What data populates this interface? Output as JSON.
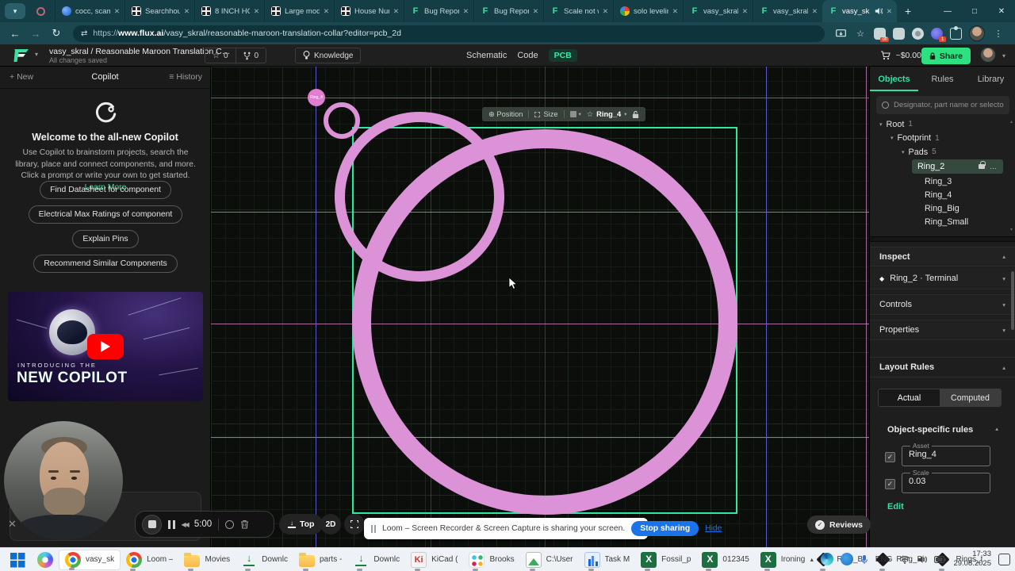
{
  "glyphs": {
    "close": "✕",
    "caret_down": "▾",
    "caret_up": "▴",
    "plus": "+",
    "hamburger": "≡",
    "back": "←",
    "forward": "→",
    "reload": "↻",
    "siteinfo": "⇄",
    "star": "☆",
    "dots_v": "⋮",
    "minimize": "—",
    "maximize": "□",
    "position": "⊕",
    "diamond": "◆",
    "ellipsis": "…",
    "check": "✓",
    "rewind": "◀◀",
    "tray_chevron": "▴",
    "arrow_down": "↓"
  },
  "browser": {
    "tabs": [
      {
        "label": "cocc, scamp",
        "icon": "blue"
      },
      {
        "label": "Searchhous",
        "icon": "grid"
      },
      {
        "label": "8 INCH HO",
        "icon": "grid"
      },
      {
        "label": "Large mode",
        "icon": "grid"
      },
      {
        "label": "House Num",
        "icon": "grid"
      },
      {
        "label": "Bug Report",
        "icon": "flux"
      },
      {
        "label": "Bug Report",
        "icon": "flux"
      },
      {
        "label": "Scale not w",
        "icon": "flux"
      },
      {
        "label": "solo levelin",
        "icon": "google"
      },
      {
        "label": "vasy_skral/",
        "icon": "flux"
      },
      {
        "label": "vasy_skral/",
        "icon": "flux"
      }
    ],
    "active_tab": {
      "label": "vasy_sk",
      "icon": "flux"
    },
    "url_prefix": "https://",
    "url_host": "www.flux.ai",
    "url_path": "/vasy_skral/reasonable-maroon-translation-collar?editor=pcb_2d"
  },
  "header": {
    "project_title": "vasy_skral / Reasonable Maroon Translation C…",
    "saved": "All changes saved",
    "stars": "0",
    "forks": "0",
    "knowledge": "Knowledge",
    "mode_schematic": "Schematic",
    "mode_code": "Code",
    "mode_pcb": "PCB",
    "cart": "~$0.00",
    "share": "Share"
  },
  "copilot": {
    "new": "New",
    "title": "Copilot",
    "history": "History",
    "welcome": "Welcome to the all-new Copilot",
    "body": "Use Copilot to brainstorm projects, search the library, place and connect components, and more. Click a prompt or write your own to get started.",
    "learn_more": "Learn More",
    "prompts": [
      "Find Datasheet for component",
      "Electrical Max Ratings of component",
      "Explain Pins",
      "Recommend Similar Components"
    ],
    "video_intro": "INTRODUCING THE",
    "video_title": "NEW COPILOT"
  },
  "canvas": {
    "toolbar": {
      "position": "Position",
      "size": "Size",
      "ring": "Ring_4"
    },
    "badge": "Ring_4",
    "rings": [
      {
        "style": "left:142px;top:45px;width:46px;height:46px;border-width:6px"
      },
      {
        "style": "left:156px;top:57px;width:214px;height:214px;border-width:13px"
      },
      {
        "style": "left:178px;top:79px;width:486px;height:486px;border-width:24px"
      }
    ],
    "lines": [
      {
        "cls": "gl h pink",
        "style": "top:183px"
      },
      {
        "cls": "gl h pink",
        "style": "top:324px"
      },
      {
        "cls": "gl h pink",
        "style": "top:467px"
      },
      {
        "cls": "gl v white",
        "style": "left:277px"
      },
      {
        "cls": "gl v white",
        "style": "left:421px"
      },
      {
        "cls": "gl v pink",
        "style": "left:826px"
      },
      {
        "cls": "gl v purple",
        "style": "left:132px"
      },
      {
        "cls": "gl v purple",
        "style": "left:700px"
      },
      {
        "cls": "gl h purple",
        "style": "top:39px"
      }
    ]
  },
  "playback": {
    "time": "5:00"
  },
  "view": {
    "top": "Top",
    "mode": "2D"
  },
  "loom_banner": {
    "text": "Loom – Screen Recorder & Screen Capture is sharing your screen.",
    "stop": "Stop sharing",
    "hide": "Hide"
  },
  "reviews": "Reviews",
  "objects_panel": {
    "tabs": [
      "Objects",
      "Rules",
      "Library"
    ],
    "search_placeholder": "Designator, part name or selector",
    "groups": [
      {
        "label": "Root",
        "count": "1",
        "style": "padding-left:12px"
      },
      {
        "label": "Footprint",
        "count": "1",
        "style": "padding-left:26px"
      },
      {
        "label": "Pads",
        "count": "5",
        "style": "padding-left:40px"
      }
    ],
    "selected_pad": "Ring_2",
    "pads": [
      "Ring_3",
      "Ring_4",
      "Ring_Big",
      "Ring_Small"
    ],
    "inspect": "Inspect",
    "terminal": "Ring_2 · Terminal",
    "controls": "Controls",
    "properties": "Properties",
    "layout_rules": "Layout Rules",
    "actual": "Actual",
    "computed": "Computed",
    "object_rules": "Object-specific rules",
    "asset_label": "Asset",
    "asset_value": "Ring_4",
    "scale_label": "Scale",
    "scale_value": "0.03",
    "edit": "Edit"
  },
  "taskbar": {
    "items": [
      {
        "icon": "start",
        "label": "",
        "state": ""
      },
      {
        "icon": "copilot",
        "label": "",
        "state": ""
      },
      {
        "icon": "chrome",
        "label": "vasy_sk",
        "state": "active"
      },
      {
        "icon": "chrome",
        "label": "Loom –",
        "state": "run"
      },
      {
        "icon": "folder",
        "label": "Movies",
        "state": "run"
      },
      {
        "icon": "down",
        "label": "Downlc",
        "state": "run"
      },
      {
        "icon": "folder",
        "label": "parts -",
        "state": "run"
      },
      {
        "icon": "down",
        "label": "Downlc",
        "state": "run"
      },
      {
        "icon": "kicad",
        "label": "KiCad (",
        "state": "run"
      },
      {
        "icon": "slack",
        "label": "Brooks",
        "state": "run"
      },
      {
        "icon": "photo",
        "label": "C:\\User",
        "state": "run"
      },
      {
        "icon": "taskmgr",
        "label": "Task M",
        "state": "run"
      },
      {
        "icon": "excel",
        "label": "Fossil_p",
        "state": "run"
      },
      {
        "icon": "excel",
        "label": "012345",
        "state": "run"
      },
      {
        "icon": "excel",
        "label": "Ironing",
        "state": "run"
      },
      {
        "icon": "inkscape",
        "label": "Ring_Bi",
        "state": "run"
      },
      {
        "icon": "inkscape",
        "label": "Ring_Bi",
        "state": "run"
      },
      {
        "icon": "inkscape",
        "label": "Rings_t",
        "state": "run"
      }
    ],
    "tray": {
      "lang": "ENG",
      "time": "17:33",
      "date": "29.08.2025"
    }
  }
}
